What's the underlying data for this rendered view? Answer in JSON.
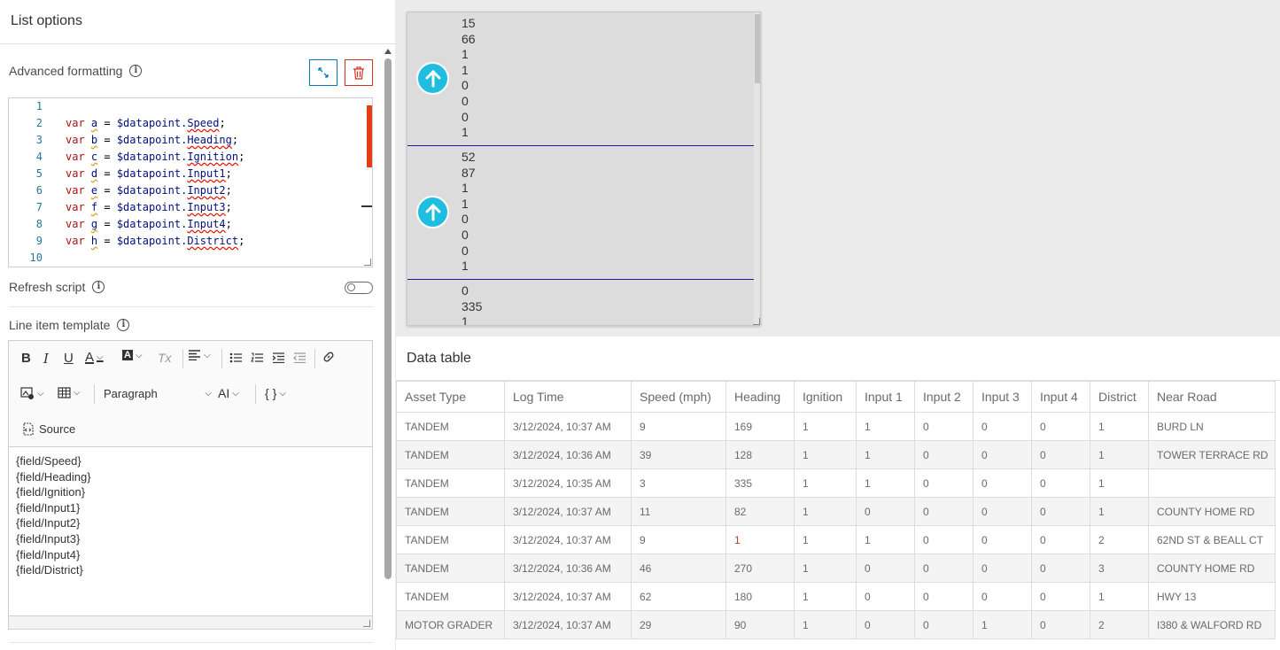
{
  "left_panel": {
    "title": "List options",
    "advanced_formatting_label": "Advanced formatting",
    "expand_icon": "expand-icon",
    "delete_icon": "trash-icon",
    "code_lines": [
      {
        "n": "1",
        "t": ""
      },
      {
        "n": "2",
        "kw": "var",
        "name": "a",
        "ref": "$datapoint.",
        "field": "Speed"
      },
      {
        "n": "3",
        "kw": "var",
        "name": "b",
        "ref": "$datapoint.",
        "field": "Heading"
      },
      {
        "n": "4",
        "kw": "var",
        "name": "c",
        "ref": "$datapoint.",
        "field": "Ignition"
      },
      {
        "n": "5",
        "kw": "var",
        "name": "d",
        "ref": "$datapoint.",
        "field": "Input1"
      },
      {
        "n": "6",
        "kw": "var",
        "name": "e",
        "ref": "$datapoint.",
        "field": "Input2"
      },
      {
        "n": "7",
        "kw": "var",
        "name": "f",
        "ref": "$datapoint.",
        "field": "Input3"
      },
      {
        "n": "8",
        "kw": "var",
        "name": "g",
        "ref": "$datapoint.",
        "field": "Input4"
      },
      {
        "n": "9",
        "kw": "var",
        "name": "h",
        "ref": "$datapoint.",
        "field": "District"
      },
      {
        "n": "10",
        "t": ""
      }
    ],
    "refresh_script_label": "Refresh script",
    "refresh_script_enabled": false,
    "line_item_template_label": "Line item template",
    "toolbar": {
      "bold": "B",
      "italic": "I",
      "underline": "U",
      "font_color": "A",
      "bg_color": "A",
      "clear": "Tx",
      "paragraph": "Paragraph",
      "ai": "AI",
      "braces": "{ }",
      "source": "Source"
    },
    "template_lines": [
      "{field/Speed}",
      "{field/Heading}",
      "{field/Ignition}",
      "{field/Input1}",
      "{field/Input2}",
      "{field/Input3}",
      "{field/Input4}",
      "{field/District}"
    ]
  },
  "list_preview": {
    "items": [
      {
        "values": [
          "15",
          "66",
          "1",
          "1",
          "0",
          "0",
          "0",
          "1"
        ]
      },
      {
        "values": [
          "52",
          "87",
          "1",
          "1",
          "0",
          "0",
          "0",
          "1"
        ]
      },
      {
        "values": [
          "0",
          "335",
          "1"
        ]
      }
    ]
  },
  "data_table": {
    "title": "Data table",
    "columns": [
      "Asset Type",
      "Log Time",
      "Speed (mph)",
      "Heading",
      "Ignition",
      "Input 1",
      "Input 2",
      "Input 3",
      "Input 4",
      "District",
      "Near Road"
    ],
    "rows": [
      [
        "TANDEM",
        "3/12/2024, 10:37 AM",
        "9",
        "169",
        "1",
        "1",
        "0",
        "0",
        "0",
        "1",
        "BURD LN"
      ],
      [
        "TANDEM",
        "3/12/2024, 10:36 AM",
        "39",
        "128",
        "1",
        "1",
        "0",
        "0",
        "0",
        "1",
        "TOWER TERRACE RD"
      ],
      [
        "TANDEM",
        "3/12/2024, 10:35 AM",
        "3",
        "335",
        "1",
        "1",
        "0",
        "0",
        "0",
        "1",
        ""
      ],
      [
        "TANDEM",
        "3/12/2024, 10:37 AM",
        "11",
        "82",
        "1",
        "0",
        "0",
        "0",
        "0",
        "1",
        "COUNTY HOME RD"
      ],
      [
        "TANDEM",
        "3/12/2024, 10:37 AM",
        "9",
        "1",
        "1",
        "1",
        "0",
        "0",
        "0",
        "2",
        "62ND ST & BEALL CT"
      ],
      [
        "TANDEM",
        "3/12/2024, 10:36 AM",
        "46",
        "270",
        "1",
        "0",
        "0",
        "0",
        "0",
        "3",
        "COUNTY HOME RD"
      ],
      [
        "TANDEM",
        "3/12/2024, 10:37 AM",
        "62",
        "180",
        "1",
        "0",
        "0",
        "0",
        "0",
        "1",
        "HWY 13"
      ],
      [
        "MOTOR GRADER",
        "3/12/2024, 10:37 AM",
        "29",
        "90",
        "1",
        "0",
        "0",
        "1",
        "0",
        "2",
        "I380 & WALFORD RD"
      ]
    ]
  },
  "colors": {
    "accent_blue": "#007ac2",
    "danger_red": "#d83020",
    "arrow_cyan": "#1fbde0"
  }
}
